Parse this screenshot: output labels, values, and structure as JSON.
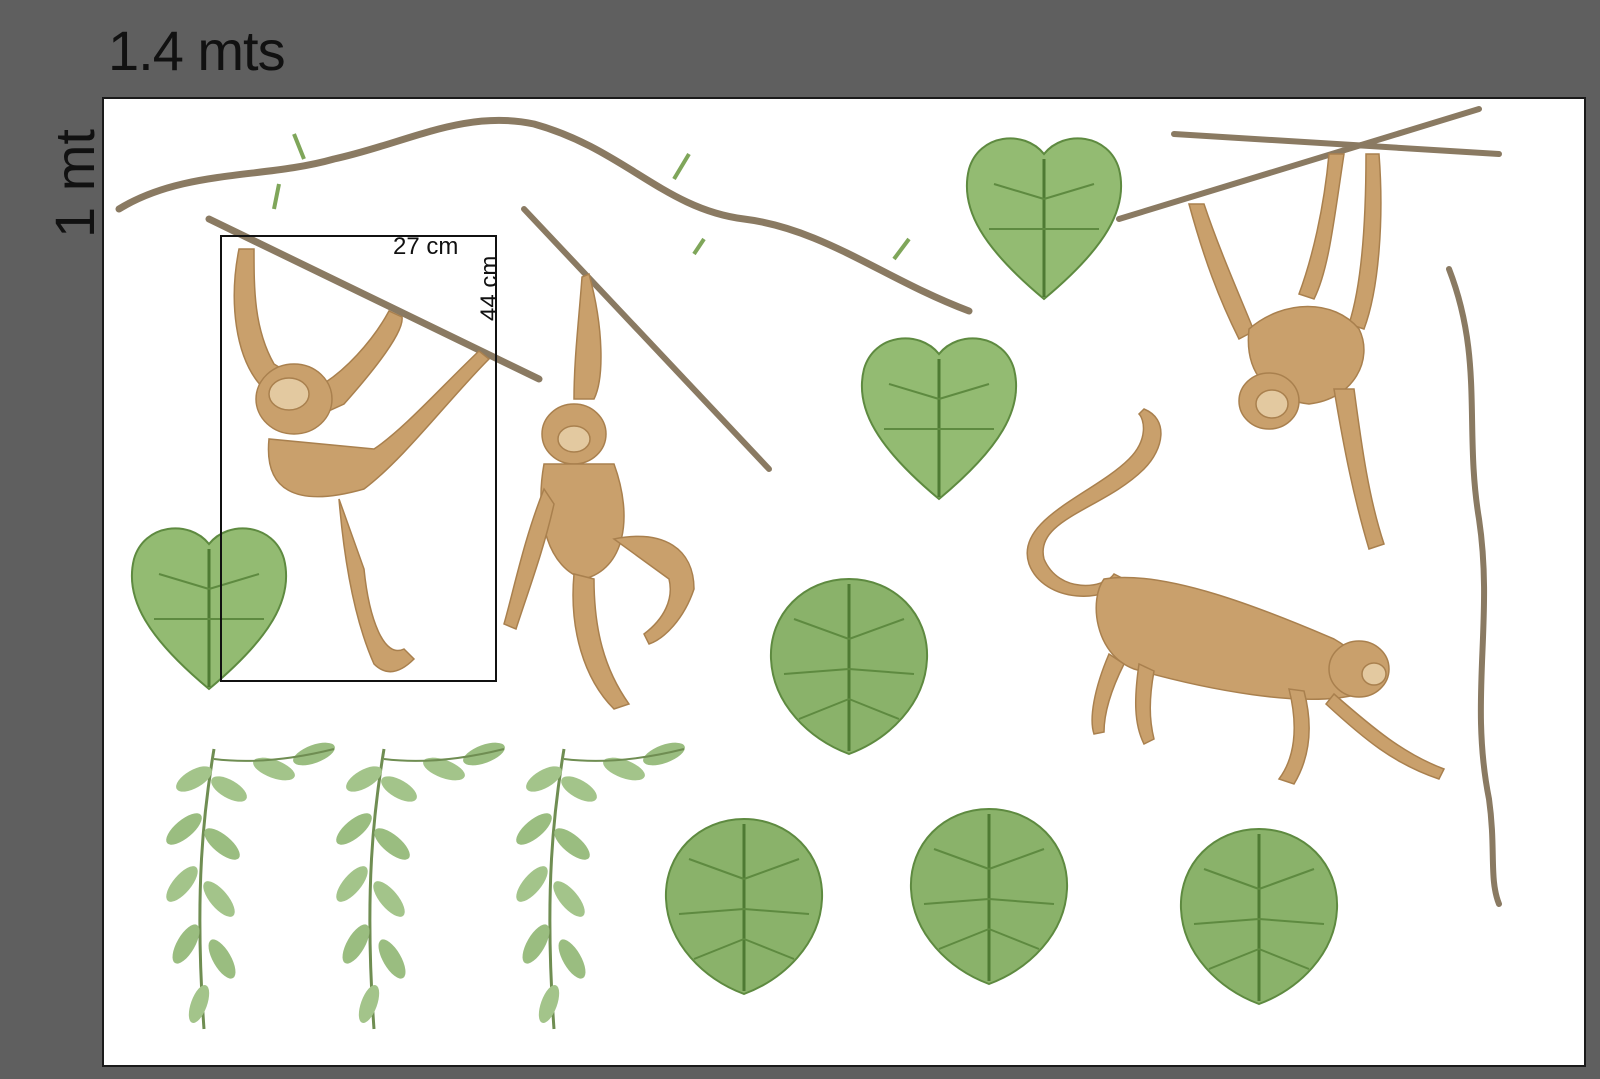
{
  "dimensions": {
    "width_label": "1.4 mts",
    "height_label": "1 mt"
  },
  "sample_measure": {
    "width_label": "27 cm",
    "height_label": "44 cm"
  },
  "colors": {
    "background": "#5f5f5f",
    "sheet": "#ffffff",
    "leaf": "#7fa65a",
    "monkey": "#c9a06c",
    "branch": "#8a7a62"
  }
}
